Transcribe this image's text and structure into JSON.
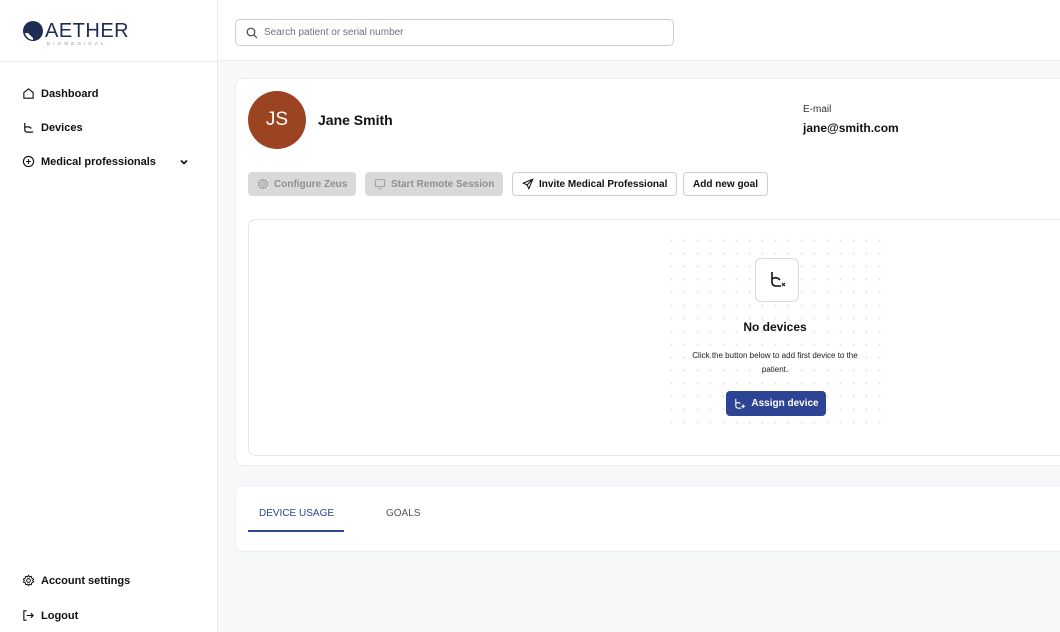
{
  "brand": {
    "name": "AETHER",
    "tagline": "BIOMEDICAL",
    "color": "#1f2d54"
  },
  "sidebar": {
    "items": [
      {
        "label": "Dashboard",
        "icon": "home-icon"
      },
      {
        "label": "Devices",
        "icon": "device-icon"
      },
      {
        "label": "Medical professionals",
        "icon": "shield-plus-icon",
        "expandable": true
      }
    ],
    "footer": [
      {
        "label": "Account settings",
        "icon": "gear-icon"
      },
      {
        "label": "Logout",
        "icon": "logout-icon"
      }
    ]
  },
  "search": {
    "placeholder": "Search patient or serial number",
    "value": ""
  },
  "patient": {
    "initials": "JS",
    "name": "Jane Smith",
    "email_label": "E-mail",
    "email": "jane@smith.com",
    "avatar_color": "#9b4421"
  },
  "actions": {
    "configure": "Configure Zeus",
    "remote": "Start Remote Session",
    "invite": "Invite Medical Professional",
    "goal": "Add new goal"
  },
  "devices_empty": {
    "title": "No devices",
    "description": "Click the button below to add first device to the patient.",
    "button": "Assign device"
  },
  "tabs": [
    {
      "label": "DEVICE USAGE",
      "active": true
    },
    {
      "label": "GOALS",
      "active": false
    }
  ],
  "colors": {
    "primary": "#2d4494",
    "disabled_bg": "#d9d9d9"
  }
}
